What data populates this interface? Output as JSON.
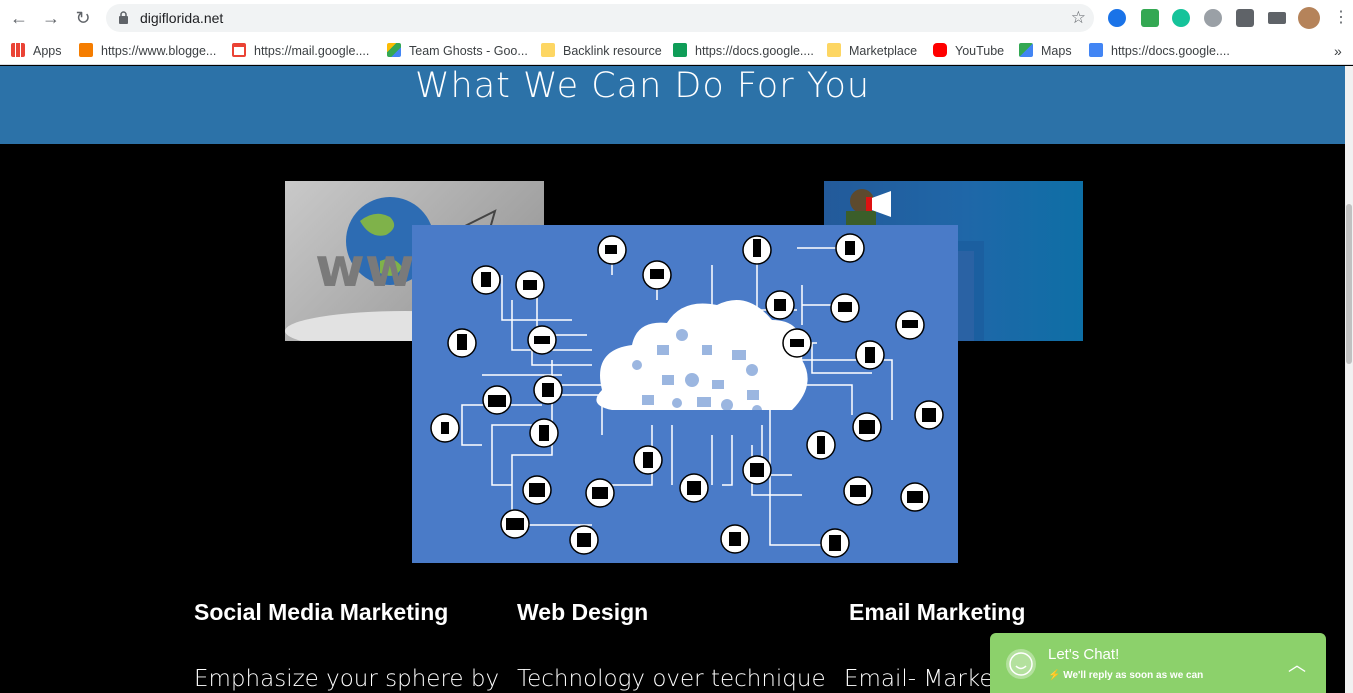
{
  "browser": {
    "url": "digiflorida.net",
    "bookmarks": [
      {
        "label": "Apps",
        "icon": "apps-grid-icon"
      },
      {
        "label": "https://www.blogge...",
        "icon": "blogger-icon"
      },
      {
        "label": "https://mail.google....",
        "icon": "gmail-icon"
      },
      {
        "label": "Team Ghosts - Goo...",
        "icon": "drive-icon"
      },
      {
        "label": "Backlink resource",
        "icon": "folder-icon"
      },
      {
        "label": "https://docs.google....",
        "icon": "sheets-icon"
      },
      {
        "label": "Marketplace",
        "icon": "folder-icon"
      },
      {
        "label": "YouTube",
        "icon": "youtube-icon"
      },
      {
        "label": "Maps",
        "icon": "maps-icon"
      },
      {
        "label": "https://docs.google....",
        "icon": "docs-icon"
      }
    ],
    "more_bookmarks": "»"
  },
  "hero": {
    "title": "What We Can Do For You"
  },
  "services": [
    {
      "title": "Social Media Marketing",
      "desc": "Emphasize your sphere by"
    },
    {
      "title": "Web Design",
      "desc": "Technology over technique"
    },
    {
      "title": "Email Marketing",
      "desc": "Email- Marketing"
    }
  ],
  "chat": {
    "title": "Let's Chat!",
    "subtitle": "We'll reply as soon as we can"
  },
  "colors": {
    "hero_bg": "#2c72a8",
    "iot_bg": "#4a7bc8",
    "chat_bg": "#8cd16b"
  }
}
